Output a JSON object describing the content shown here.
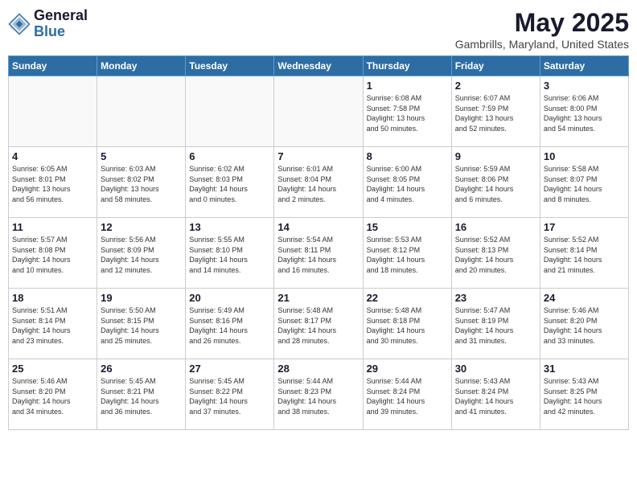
{
  "header": {
    "logo_general": "General",
    "logo_blue": "Blue",
    "month": "May 2025",
    "location": "Gambrills, Maryland, United States"
  },
  "weekdays": [
    "Sunday",
    "Monday",
    "Tuesday",
    "Wednesday",
    "Thursday",
    "Friday",
    "Saturday"
  ],
  "weeks": [
    [
      {
        "day": "",
        "info": ""
      },
      {
        "day": "",
        "info": ""
      },
      {
        "day": "",
        "info": ""
      },
      {
        "day": "",
        "info": ""
      },
      {
        "day": "1",
        "info": "Sunrise: 6:08 AM\nSunset: 7:58 PM\nDaylight: 13 hours\nand 50 minutes."
      },
      {
        "day": "2",
        "info": "Sunrise: 6:07 AM\nSunset: 7:59 PM\nDaylight: 13 hours\nand 52 minutes."
      },
      {
        "day": "3",
        "info": "Sunrise: 6:06 AM\nSunset: 8:00 PM\nDaylight: 13 hours\nand 54 minutes."
      }
    ],
    [
      {
        "day": "4",
        "info": "Sunrise: 6:05 AM\nSunset: 8:01 PM\nDaylight: 13 hours\nand 56 minutes."
      },
      {
        "day": "5",
        "info": "Sunrise: 6:03 AM\nSunset: 8:02 PM\nDaylight: 13 hours\nand 58 minutes."
      },
      {
        "day": "6",
        "info": "Sunrise: 6:02 AM\nSunset: 8:03 PM\nDaylight: 14 hours\nand 0 minutes."
      },
      {
        "day": "7",
        "info": "Sunrise: 6:01 AM\nSunset: 8:04 PM\nDaylight: 14 hours\nand 2 minutes."
      },
      {
        "day": "8",
        "info": "Sunrise: 6:00 AM\nSunset: 8:05 PM\nDaylight: 14 hours\nand 4 minutes."
      },
      {
        "day": "9",
        "info": "Sunrise: 5:59 AM\nSunset: 8:06 PM\nDaylight: 14 hours\nand 6 minutes."
      },
      {
        "day": "10",
        "info": "Sunrise: 5:58 AM\nSunset: 8:07 PM\nDaylight: 14 hours\nand 8 minutes."
      }
    ],
    [
      {
        "day": "11",
        "info": "Sunrise: 5:57 AM\nSunset: 8:08 PM\nDaylight: 14 hours\nand 10 minutes."
      },
      {
        "day": "12",
        "info": "Sunrise: 5:56 AM\nSunset: 8:09 PM\nDaylight: 14 hours\nand 12 minutes."
      },
      {
        "day": "13",
        "info": "Sunrise: 5:55 AM\nSunset: 8:10 PM\nDaylight: 14 hours\nand 14 minutes."
      },
      {
        "day": "14",
        "info": "Sunrise: 5:54 AM\nSunset: 8:11 PM\nDaylight: 14 hours\nand 16 minutes."
      },
      {
        "day": "15",
        "info": "Sunrise: 5:53 AM\nSunset: 8:12 PM\nDaylight: 14 hours\nand 18 minutes."
      },
      {
        "day": "16",
        "info": "Sunrise: 5:52 AM\nSunset: 8:13 PM\nDaylight: 14 hours\nand 20 minutes."
      },
      {
        "day": "17",
        "info": "Sunrise: 5:52 AM\nSunset: 8:14 PM\nDaylight: 14 hours\nand 21 minutes."
      }
    ],
    [
      {
        "day": "18",
        "info": "Sunrise: 5:51 AM\nSunset: 8:14 PM\nDaylight: 14 hours\nand 23 minutes."
      },
      {
        "day": "19",
        "info": "Sunrise: 5:50 AM\nSunset: 8:15 PM\nDaylight: 14 hours\nand 25 minutes."
      },
      {
        "day": "20",
        "info": "Sunrise: 5:49 AM\nSunset: 8:16 PM\nDaylight: 14 hours\nand 26 minutes."
      },
      {
        "day": "21",
        "info": "Sunrise: 5:48 AM\nSunset: 8:17 PM\nDaylight: 14 hours\nand 28 minutes."
      },
      {
        "day": "22",
        "info": "Sunrise: 5:48 AM\nSunset: 8:18 PM\nDaylight: 14 hours\nand 30 minutes."
      },
      {
        "day": "23",
        "info": "Sunrise: 5:47 AM\nSunset: 8:19 PM\nDaylight: 14 hours\nand 31 minutes."
      },
      {
        "day": "24",
        "info": "Sunrise: 5:46 AM\nSunset: 8:20 PM\nDaylight: 14 hours\nand 33 minutes."
      }
    ],
    [
      {
        "day": "25",
        "info": "Sunrise: 5:46 AM\nSunset: 8:20 PM\nDaylight: 14 hours\nand 34 minutes."
      },
      {
        "day": "26",
        "info": "Sunrise: 5:45 AM\nSunset: 8:21 PM\nDaylight: 14 hours\nand 36 minutes."
      },
      {
        "day": "27",
        "info": "Sunrise: 5:45 AM\nSunset: 8:22 PM\nDaylight: 14 hours\nand 37 minutes."
      },
      {
        "day": "28",
        "info": "Sunrise: 5:44 AM\nSunset: 8:23 PM\nDaylight: 14 hours\nand 38 minutes."
      },
      {
        "day": "29",
        "info": "Sunrise: 5:44 AM\nSunset: 8:24 PM\nDaylight: 14 hours\nand 39 minutes."
      },
      {
        "day": "30",
        "info": "Sunrise: 5:43 AM\nSunset: 8:24 PM\nDaylight: 14 hours\nand 41 minutes."
      },
      {
        "day": "31",
        "info": "Sunrise: 5:43 AM\nSunset: 8:25 PM\nDaylight: 14 hours\nand 42 minutes."
      }
    ]
  ]
}
